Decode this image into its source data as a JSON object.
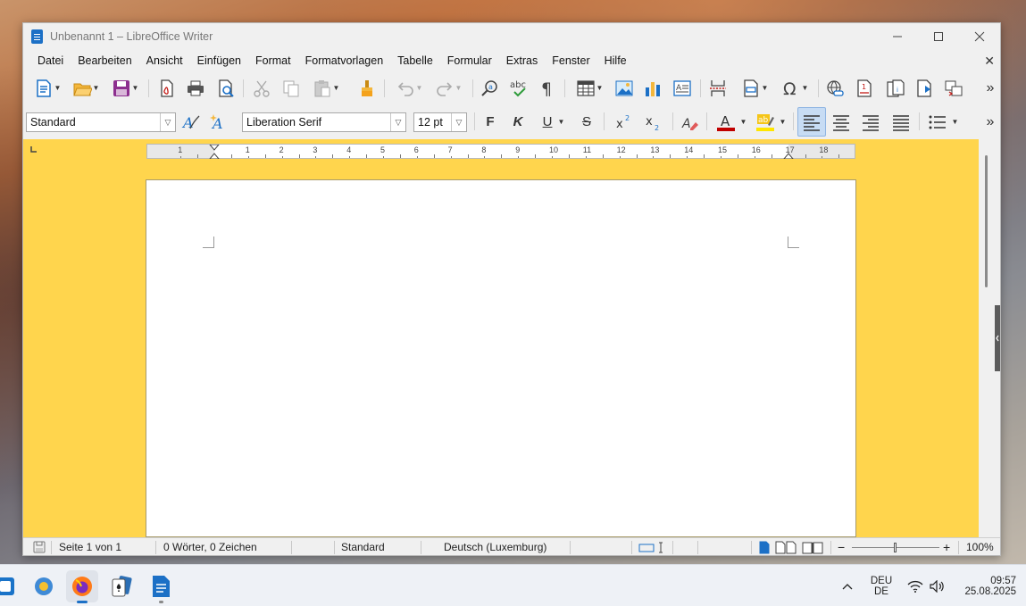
{
  "window": {
    "title": "Unbenannt 1 – LibreOffice Writer"
  },
  "menubar": {
    "items": [
      "Datei",
      "Bearbeiten",
      "Ansicht",
      "Einfügen",
      "Format",
      "Formatvorlagen",
      "Tabelle",
      "Formular",
      "Extras",
      "Fenster",
      "Hilfe"
    ]
  },
  "formatting": {
    "paragraph_style": "Standard",
    "font_name": "Liberation Serif",
    "font_size": "12 pt",
    "bold_label": "F",
    "italic_label": "K",
    "underline_label": "U",
    "strike_label": "S"
  },
  "ruler": {
    "labels": [
      "1",
      "1",
      "2",
      "3",
      "4",
      "5",
      "6",
      "7",
      "8",
      "9",
      "10",
      "11",
      "12",
      "13",
      "14",
      "15",
      "16",
      "17",
      "18"
    ]
  },
  "statusbar": {
    "page": "Seite 1 von 1",
    "words": "0 Wörter, 0 Zeichen",
    "style": "Standard",
    "language": "Deutsch (Luxemburg)",
    "zoom": "100%"
  },
  "taskbar": {
    "lang_line1": "DEU",
    "lang_line2": "DE",
    "time": "09:57",
    "date": "25.08.2025"
  },
  "colors": {
    "background": "#ffd54d",
    "accent": "#1c70c6",
    "font_color": "#c00000",
    "highlight": "#ffe600"
  },
  "icons": [
    "new-document-icon",
    "open-folder-icon",
    "save-icon",
    "export-pdf-icon",
    "print-icon",
    "print-preview-icon",
    "cut-icon",
    "copy-icon",
    "paste-icon",
    "clone-formatting-icon",
    "undo-icon",
    "redo-icon",
    "find-replace-icon",
    "spelling-icon",
    "formatting-marks-icon",
    "insert-table-icon",
    "insert-image-icon",
    "insert-chart-icon",
    "insert-textbox-icon",
    "page-break-icon",
    "insert-field-icon",
    "special-character-icon",
    "hyperlink-icon",
    "footnote-icon",
    "endnote-icon",
    "bookmark-icon",
    "cross-reference-icon"
  ]
}
